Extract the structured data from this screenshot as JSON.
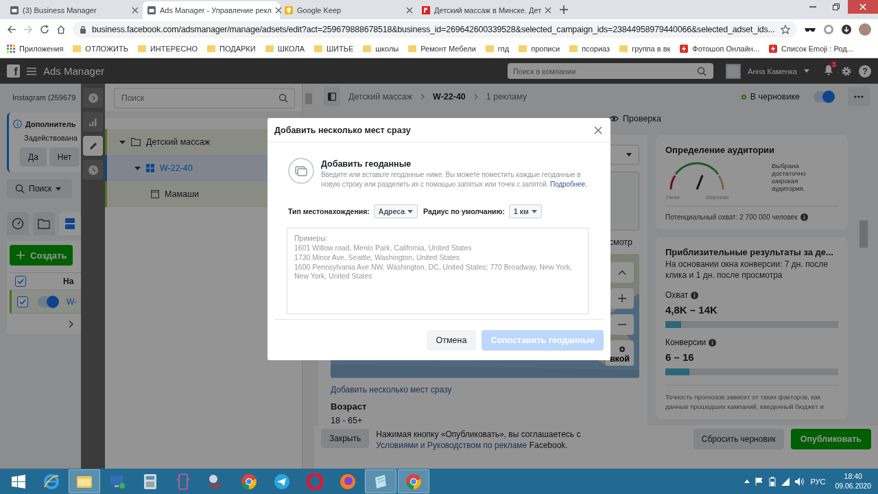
{
  "browser": {
    "tabs": [
      {
        "title": "(3) Business Manager",
        "kind": "manager",
        "selected": false
      },
      {
        "title": "Ads Manager - Управление рекл",
        "kind": "manager",
        "selected": true
      },
      {
        "title": "Google Keep",
        "kind": "keep",
        "selected": false
      },
      {
        "title": "Детский массаж в Минске. Дет",
        "kind": "site",
        "selected": false
      }
    ],
    "url": "business.facebook.com/adsmanager/manage/adsets/edit?act=259679888678518&business_id=269642600339528&selected_campaign_ids=23844958979440066&selected_adset_ids...",
    "bookmarks": [
      {
        "label": "Приложения",
        "kind": "apps"
      },
      {
        "label": "ОТЛОЖИТЬ",
        "kind": "folder"
      },
      {
        "label": "ИНТЕРЕСНО",
        "kind": "folder"
      },
      {
        "label": "ПОДАРКИ",
        "kind": "folder"
      },
      {
        "label": "ШКОЛА",
        "kind": "folder"
      },
      {
        "label": "ШИТЬЕ",
        "kind": "folder"
      },
      {
        "label": "школы",
        "kind": "folder"
      },
      {
        "label": "Ремонт Мебели",
        "kind": "folder"
      },
      {
        "label": "гпд",
        "kind": "folder"
      },
      {
        "label": "прописи",
        "kind": "folder"
      },
      {
        "label": "псориаз",
        "kind": "folder"
      },
      {
        "label": "группа в вк",
        "kind": "folder"
      },
      {
        "label": "Фотошоп Онлайн...",
        "kind": "site"
      },
      {
        "label": "Список Emoji : Род...",
        "kind": "site"
      }
    ]
  },
  "fb_header": {
    "logo": "f",
    "title": "Ads Manager",
    "search_placeholder": "Поиск в компании",
    "user": "Анна Каменка",
    "notifications": "3",
    "help": "?"
  },
  "left_panel": {
    "account": "Instagram (259679",
    "notice": {
      "title": "Дополнитель",
      "text": "Задействована",
      "buttons": [
        "Да",
        "Нет"
      ]
    },
    "search_button": "Поиск",
    "view_tabs": [
      {
        "kind": "performance",
        "selected": false
      },
      {
        "kind": "campaigns",
        "selected": false
      },
      {
        "kind": "adsets",
        "selected": true
      }
    ],
    "create_button": "Создать",
    "table": {
      "header_checked": true,
      "column": "На",
      "rows": [
        {
          "checked": true,
          "on": true,
          "name": "W-"
        }
      ]
    }
  },
  "tool_strip": [
    {
      "kind": "expand",
      "selected": false
    },
    {
      "kind": "charts",
      "selected": false
    },
    {
      "kind": "edit",
      "selected": true
    },
    {
      "kind": "history",
      "selected": false
    }
  ],
  "tree": {
    "search_placeholder": "Поиск",
    "items": [
      {
        "label": "Детский массаж",
        "kind": "campaign",
        "expanded": true,
        "selected": false,
        "children": [
          {
            "label": "W-22-40",
            "kind": "adset",
            "expanded": true,
            "selected": true,
            "children": [
              {
                "label": "Мамаши",
                "kind": "ad",
                "selected": false
              }
            ]
          }
        ]
      }
    ]
  },
  "editor": {
    "breadcrumb": [
      {
        "label": "Детский массаж",
        "current": false
      },
      {
        "label": "W-22-40",
        "current": true
      },
      {
        "label": "1 рекламу",
        "current": false
      }
    ],
    "status": "В черновике",
    "toggle_on": true,
    "review_tab": "Проверка",
    "map_tab": "смотр",
    "map_button": "вкой",
    "add_places_link": "Добавить несколько мест сразу",
    "age_label": "Возраст",
    "age_value": "18 - 65+"
  },
  "audience": {
    "title": "Определение аудитории",
    "gauge": {
      "narrow": "Узкая",
      "wide": "Широкая"
    },
    "verdict": "Выбрана достаточно широкая аудитория.",
    "reach": "Потенциальный охват: 2 700 000 человек"
  },
  "results": {
    "title": "Приблизительные результаты за де...",
    "subtitle": "На основании окна конверсии: 7 дн. после клика и 1 дн. после просмотра",
    "metrics": [
      {
        "label": "Охват",
        "value": "4,8K – 14K",
        "level": 0.09
      },
      {
        "label": "Конверсии",
        "value": "6 – 16",
        "level": 0.14
      }
    ],
    "note": "Точность прогнозов зависит от таких факторов, как данные прошедших кампаний, введенный бюджет и"
  },
  "footer": {
    "close": "Закрыть",
    "notice_before": "Нажимая кнопку «Опубликовать», вы соглашаетесь с",
    "notice_link": "Условиями и Руководством по рекламе",
    "notice_after": "Facebook.",
    "reset": "Сбросить черновик",
    "publish": "Опубликовать"
  },
  "modal": {
    "title": "Добавить несколько мест сразу",
    "heading": "Добавить геоданные",
    "description": "Введите или вставьте геоданные ниже. Вы можете поместить каждые геоданные в новую строку или разделить их с помощью запятых или точек с запятой.",
    "more_link": "Подробнее.",
    "type_label": "Тип местонахождения:",
    "type_value": "Адреса",
    "radius_label": "Радиус по умолчанию:",
    "radius_value": "1 км",
    "placeholder": "Примеры:\n1601 Willow road, Menlo Park, California, United States\n1730 Minor Ave, Seattle, Washington, United States\n1600 Pennsylvania Ave NW, Washington, DC, United States; 770 Broadway, New York, New York, United States",
    "cancel": "Отмена",
    "submit": "Сопоставить геоданные",
    "submit_disabled": true
  },
  "taskbar": {
    "apps": [
      {
        "kind": "ie",
        "selected": false
      },
      {
        "kind": "explorer",
        "selected": true
      },
      {
        "kind": "remote",
        "selected": false
      },
      {
        "kind": "calculator",
        "selected": false
      },
      {
        "kind": "phone",
        "selected": false
      },
      {
        "kind": "scissors",
        "selected": false
      },
      {
        "kind": "chrome",
        "selected": false
      },
      {
        "kind": "telegram",
        "selected": false
      },
      {
        "kind": "opera",
        "selected": false
      },
      {
        "kind": "firefox",
        "selected": false
      },
      {
        "kind": "notepad",
        "selected": true
      },
      {
        "kind": "chrome",
        "selected": true
      }
    ],
    "language": "РУС",
    "time": "18:40",
    "date": "09.06.2020"
  }
}
